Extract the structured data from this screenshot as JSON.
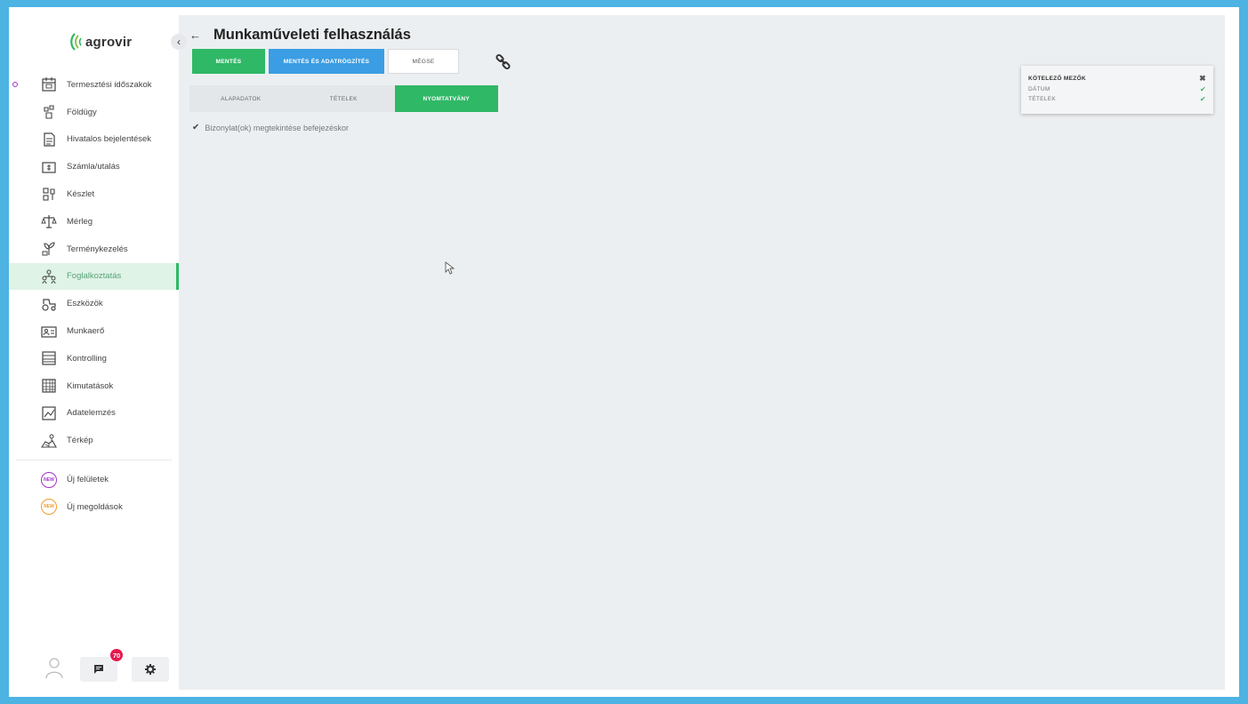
{
  "brand": {
    "name": "agrovir"
  },
  "sidebar": {
    "collapse_glyph": "‹",
    "items": [
      {
        "label": "Termesztési időszakok",
        "icon": "calendar-icon",
        "active": false,
        "dot": true
      },
      {
        "label": "Földügy",
        "icon": "land-icon",
        "active": false
      },
      {
        "label": "Hivatalos bejelentések",
        "icon": "document-icon",
        "active": false
      },
      {
        "label": "Számla/utalás",
        "icon": "invoice-icon",
        "active": false
      },
      {
        "label": "Készlet",
        "icon": "stock-icon",
        "active": false
      },
      {
        "label": "Mérleg",
        "icon": "scale-icon",
        "active": false
      },
      {
        "label": "Terménykezelés",
        "icon": "crop-icon",
        "active": false
      },
      {
        "label": "Foglalkoztatás",
        "icon": "employment-icon",
        "active": true
      },
      {
        "label": "Eszközök",
        "icon": "tractor-icon",
        "active": false
      },
      {
        "label": "Munkaerő",
        "icon": "id-card-icon",
        "active": false
      },
      {
        "label": "Kontrolling",
        "icon": "calculator-icon",
        "active": false
      },
      {
        "label": "Kimutatások",
        "icon": "table-icon",
        "active": false
      },
      {
        "label": "Adatelemzés",
        "icon": "analytics-icon",
        "active": false
      },
      {
        "label": "Térkép",
        "icon": "map-icon",
        "active": false
      }
    ],
    "extra_items": [
      {
        "label": "Új felületek",
        "icon": "new-badge-icon",
        "color": "#a232c7",
        "badge_text": "NEW"
      },
      {
        "label": "Új megoldások",
        "icon": "new-badge-icon",
        "color": "#f29a2e",
        "badge_text": "NEW"
      }
    ],
    "notifications_count": "70"
  },
  "header": {
    "back_glyph": "←",
    "title": "Munkaműveleti felhasználás"
  },
  "toolbar": {
    "save_label": "MENTÉS",
    "save_lock_label": "MENTÉS ÉS ADATRÖGZÍTÉS",
    "cancel_label": "MÉGSE"
  },
  "tabs": [
    {
      "label": "ALAPADATOK",
      "active": false
    },
    {
      "label": "TÉTELEK",
      "active": false
    },
    {
      "label": "NYOMTATVÁNY",
      "active": true
    }
  ],
  "print_options": {
    "checkbox_checked": true,
    "checkbox_label": "Bizonylat(ok) megtekintése befejezéskor"
  },
  "required_fields": {
    "title": "KÖTELEZŐ MEZŐK",
    "close_glyph": "✖",
    "items": [
      {
        "label": "DÁTUM",
        "ok": true
      },
      {
        "label": "TÉTELEK",
        "ok": true
      }
    ]
  },
  "colors": {
    "accent_green": "#2fb866",
    "accent_blue": "#3b9de3",
    "frame_blue": "#4cb3e3",
    "badge_red": "#e8194f"
  }
}
